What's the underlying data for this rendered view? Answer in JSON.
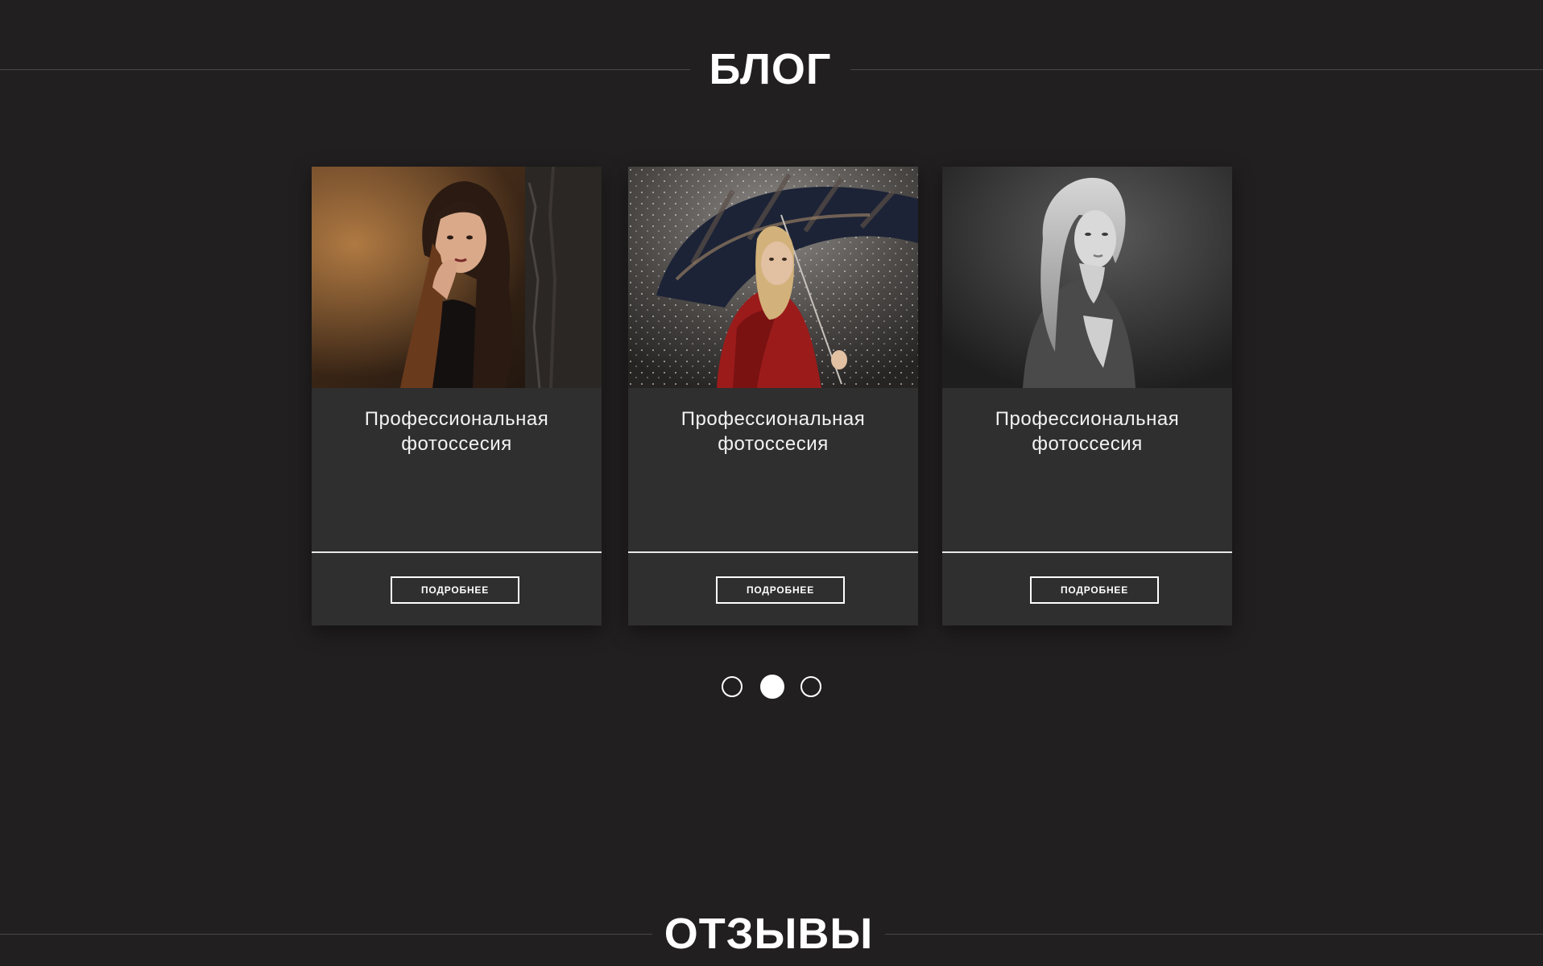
{
  "blog": {
    "heading": "БЛОГ",
    "cards": [
      {
        "title_line1": "Профессиональная",
        "title_line2": "фотоссесия",
        "button_label": "ПОДРОБНЕЕ",
        "photo": "woman-dark-hair-autumn-forest"
      },
      {
        "title_line1": "Профессиональная",
        "title_line2": "фотоссесия",
        "button_label": "ПОДРОБНЕЕ",
        "photo": "woman-red-coat-umbrella-rain"
      },
      {
        "title_line1": "Профессиональная",
        "title_line2": "фотоссесия",
        "button_label": "ПОДРОБНЕЕ",
        "photo": "woman-blonde-black-and-white"
      }
    ]
  },
  "pagination": {
    "count": 3,
    "active_index": 1
  },
  "reviews": {
    "heading": "ОТЗЫВЫ"
  },
  "colors": {
    "background": "#221f20",
    "card": "#2f2f2f",
    "text": "#ffffff",
    "rule": "#4a4748"
  }
}
